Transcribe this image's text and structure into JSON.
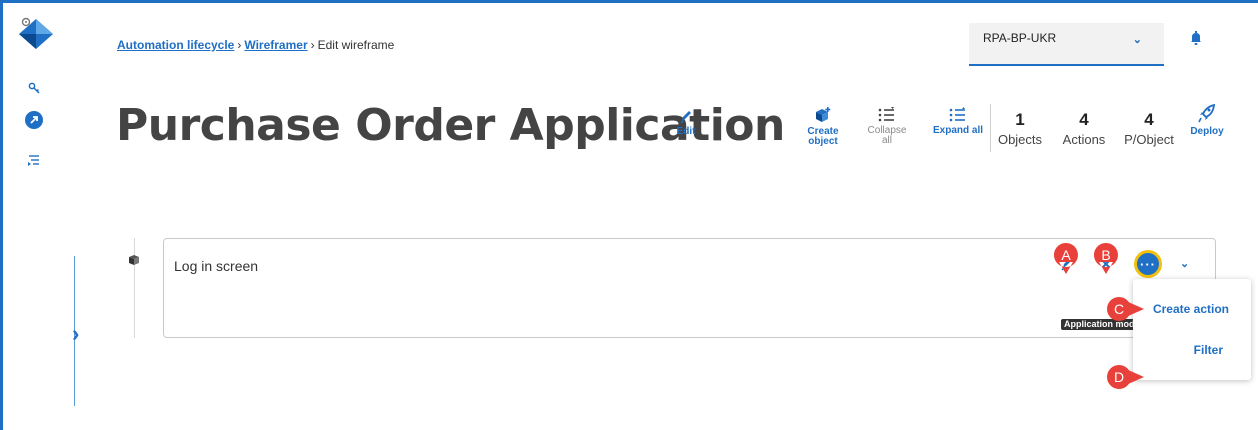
{
  "breadcrumb": {
    "items": [
      "Automation lifecycle",
      "Wireframer"
    ],
    "current": "Edit wireframe",
    "separator": "›"
  },
  "environment": {
    "selected": "RPA-BP-UKR"
  },
  "page": {
    "title": "Purchase Order Application"
  },
  "toolbar": {
    "edit": "Edit",
    "create_object": [
      "Create",
      "object"
    ],
    "collapse_all": [
      "Collapse",
      "all"
    ],
    "expand_all": "Expand all",
    "deploy": "Deploy"
  },
  "stats": [
    {
      "value": "1",
      "label": "Objects"
    },
    {
      "value": "4",
      "label": "Actions"
    },
    {
      "value": "4",
      "label": "P/Object"
    }
  ],
  "object_card": {
    "title": "Log in screen",
    "tooltip": "Application mod"
  },
  "action_menu": {
    "items": [
      "Create action",
      "Filter"
    ]
  },
  "callouts": [
    "A",
    "B",
    "C",
    "D"
  ],
  "colors": {
    "accent": "#1f6fc4",
    "callout": "#e8403a",
    "focus_ring": "#f2c010"
  }
}
